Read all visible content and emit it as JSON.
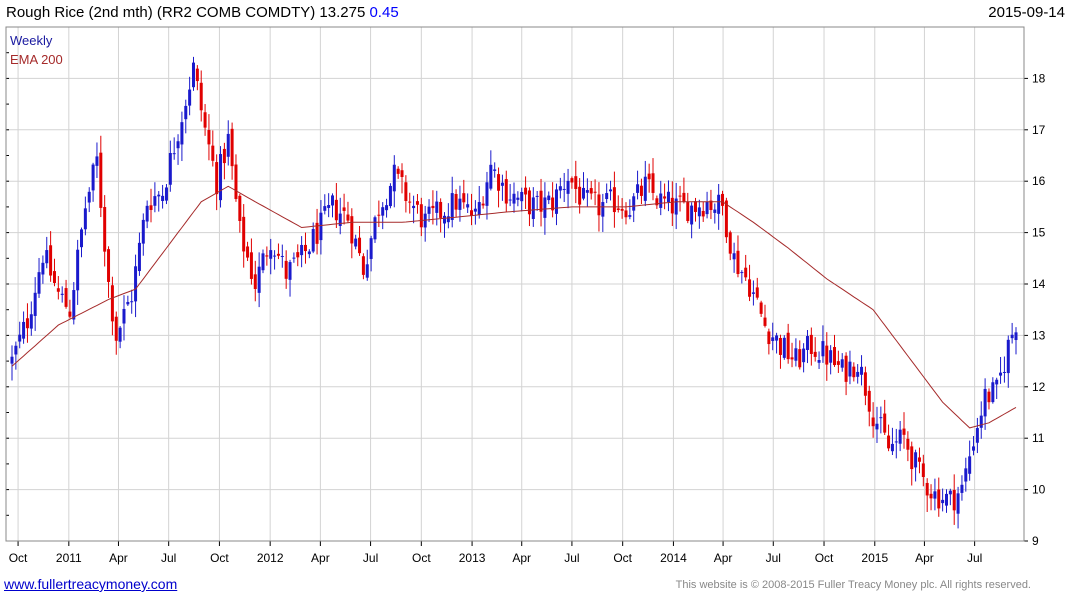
{
  "header": {
    "symbol_title": "Rough Rice (2nd mth) (RR2 COMB COMDTY)",
    "last_price": "13.275",
    "change": "0.45",
    "date": "2015-09-14"
  },
  "legend": {
    "weekly": "Weekly",
    "ema": "EMA 200"
  },
  "footer": {
    "site": "www.fullertreacymoney.com",
    "copyright": "This website is © 2008-2015 Fuller Treacy Money plc. All rights reserved."
  },
  "colors": {
    "up": "#1a1acc",
    "down": "#e00000",
    "ema": "#a52a2a",
    "grid": "#d3d3d3",
    "legend_weekly": "#1a1aa0",
    "legend_ema": "#a52a2a"
  },
  "chart_data": {
    "type": "candlestick",
    "frequency": "weekly",
    "x_start": "2010-09-20",
    "x_end": "2015-09-14",
    "ylim": [
      9,
      19
    ],
    "y_ticks": [
      9,
      10,
      11,
      12,
      13,
      14,
      15,
      16,
      17,
      18
    ],
    "x_ticks": [
      {
        "date": "2010-10-01",
        "label": "Oct"
      },
      {
        "date": "2011-01-01",
        "label": "2011"
      },
      {
        "date": "2011-04-01",
        "label": "Apr"
      },
      {
        "date": "2011-07-01",
        "label": "Jul"
      },
      {
        "date": "2011-10-01",
        "label": "Oct"
      },
      {
        "date": "2012-01-01",
        "label": "2012"
      },
      {
        "date": "2012-04-01",
        "label": "Apr"
      },
      {
        "date": "2012-07-01",
        "label": "Jul"
      },
      {
        "date": "2012-10-01",
        "label": "Oct"
      },
      {
        "date": "2013-01-01",
        "label": "2013"
      },
      {
        "date": "2013-04-01",
        "label": "Apr"
      },
      {
        "date": "2013-07-01",
        "label": "Jul"
      },
      {
        "date": "2013-10-01",
        "label": "Oct"
      },
      {
        "date": "2014-01-01",
        "label": "2014"
      },
      {
        "date": "2014-04-01",
        "label": "Apr"
      },
      {
        "date": "2014-07-01",
        "label": "Jul"
      },
      {
        "date": "2014-10-01",
        "label": "Oct"
      },
      {
        "date": "2015-01-01",
        "label": "2015"
      },
      {
        "date": "2015-04-01",
        "label": "Apr"
      },
      {
        "date": "2015-07-01",
        "label": "Jul"
      }
    ],
    "close_path": [
      [
        "2010-09-20",
        12.5
      ],
      [
        "2010-10-18",
        13.3
      ],
      [
        "2010-11-15",
        14.6
      ],
      [
        "2010-12-13",
        13.8
      ],
      [
        "2011-01-03",
        13.5
      ],
      [
        "2011-01-31",
        15.5
      ],
      [
        "2011-02-21",
        16.4
      ],
      [
        "2011-03-14",
        14.0
      ],
      [
        "2011-03-28",
        13.0
      ],
      [
        "2011-04-25",
        13.8
      ],
      [
        "2011-05-23",
        15.6
      ],
      [
        "2011-06-20",
        15.8
      ],
      [
        "2011-07-18",
        17.0
      ],
      [
        "2011-08-15",
        18.2
      ],
      [
        "2011-09-05",
        17.0
      ],
      [
        "2011-09-26",
        16.0
      ],
      [
        "2011-10-17",
        16.8
      ],
      [
        "2011-11-07",
        15.0
      ],
      [
        "2011-12-05",
        14.0
      ],
      [
        "2012-01-02",
        14.9
      ],
      [
        "2012-01-30",
        14.2
      ],
      [
        "2012-02-27",
        14.5
      ],
      [
        "2012-03-26",
        15.0
      ],
      [
        "2012-04-23",
        15.5
      ],
      [
        "2012-05-21",
        15.3
      ],
      [
        "2012-06-18",
        14.3
      ],
      [
        "2012-07-16",
        15.5
      ],
      [
        "2012-08-13",
        16.1
      ],
      [
        "2012-09-10",
        15.6
      ],
      [
        "2012-10-08",
        15.2
      ],
      [
        "2012-11-05",
        15.4
      ],
      [
        "2012-12-03",
        15.6
      ],
      [
        "2013-01-07",
        15.3
      ],
      [
        "2013-02-04",
        16.3
      ],
      [
        "2013-03-04",
        15.8
      ],
      [
        "2013-04-01",
        15.6
      ],
      [
        "2013-04-29",
        15.5
      ],
      [
        "2013-05-27",
        15.6
      ],
      [
        "2013-06-24",
        16.1
      ],
      [
        "2013-07-22",
        15.6
      ],
      [
        "2013-08-19",
        15.5
      ],
      [
        "2013-09-16",
        15.6
      ],
      [
        "2013-10-14",
        15.5
      ],
      [
        "2013-11-11",
        15.9
      ],
      [
        "2013-12-09",
        15.6
      ],
      [
        "2014-01-06",
        15.5
      ],
      [
        "2014-02-03",
        15.5
      ],
      [
        "2014-03-03",
        15.6
      ],
      [
        "2014-03-31",
        15.5
      ],
      [
        "2014-04-21",
        14.5
      ],
      [
        "2014-05-19",
        14.0
      ],
      [
        "2014-06-16",
        13.2
      ],
      [
        "2014-07-14",
        12.8
      ],
      [
        "2014-08-11",
        12.5
      ],
      [
        "2014-09-08",
        12.8
      ],
      [
        "2014-10-06",
        12.6
      ],
      [
        "2014-11-03",
        12.3
      ],
      [
        "2014-12-01",
        12.5
      ],
      [
        "2014-12-29",
        11.5
      ],
      [
        "2015-01-26",
        10.8
      ],
      [
        "2015-02-23",
        11.0
      ],
      [
        "2015-03-23",
        10.3
      ],
      [
        "2015-04-20",
        9.9
      ],
      [
        "2015-05-18",
        9.8
      ],
      [
        "2015-06-08",
        10.0
      ],
      [
        "2015-06-29",
        11.0
      ],
      [
        "2015-07-20",
        11.8
      ],
      [
        "2015-08-10",
        11.9
      ],
      [
        "2015-08-31",
        12.8
      ],
      [
        "2015-09-14",
        13.275
      ]
    ],
    "ema_path": [
      [
        "2010-09-20",
        12.4
      ],
      [
        "2010-12-13",
        13.2
      ],
      [
        "2011-03-14",
        13.7
      ],
      [
        "2011-05-02",
        13.9
      ],
      [
        "2011-07-04",
        14.8
      ],
      [
        "2011-08-29",
        15.6
      ],
      [
        "2011-10-17",
        15.9
      ],
      [
        "2011-12-05",
        15.6
      ],
      [
        "2012-02-27",
        15.1
      ],
      [
        "2012-05-28",
        15.2
      ],
      [
        "2012-08-27",
        15.2
      ],
      [
        "2012-12-03",
        15.3
      ],
      [
        "2013-03-04",
        15.4
      ],
      [
        "2013-07-01",
        15.5
      ],
      [
        "2013-10-07",
        15.5
      ],
      [
        "2014-01-06",
        15.6
      ],
      [
        "2014-03-31",
        15.6
      ],
      [
        "2014-05-26",
        15.2
      ],
      [
        "2014-07-28",
        14.7
      ],
      [
        "2014-10-06",
        14.1
      ],
      [
        "2014-12-29",
        13.5
      ],
      [
        "2015-03-02",
        12.6
      ],
      [
        "2015-05-04",
        11.7
      ],
      [
        "2015-06-22",
        11.2
      ],
      [
        "2015-07-27",
        11.3
      ],
      [
        "2015-09-14",
        11.6
      ]
    ]
  }
}
